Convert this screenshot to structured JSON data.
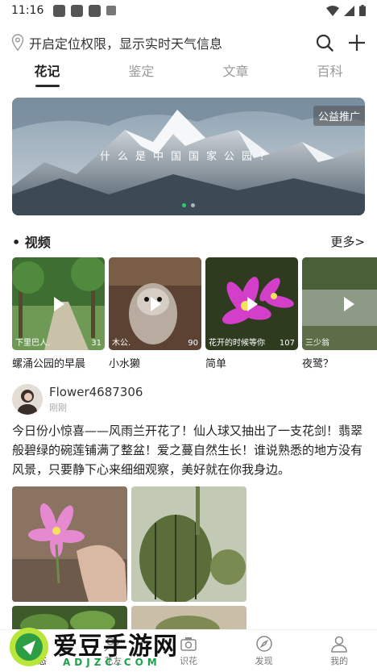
{
  "status_bar": {
    "time": "11:16"
  },
  "location": {
    "text": "开启定位权限，显示实时天气信息"
  },
  "tabs": [
    {
      "label": "花记"
    },
    {
      "label": "鉴定"
    },
    {
      "label": "文章"
    },
    {
      "label": "百科"
    }
  ],
  "banner": {
    "badge": "公益推广",
    "caption": "什么是中国国家公园？"
  },
  "videos_section": {
    "title": "视频",
    "more": "更多>",
    "items": [
      {
        "user": "下里巴人.",
        "count": "31",
        "title": "螺涌公园的早晨"
      },
      {
        "user": "木公.",
        "count": "90",
        "title": "小水獭"
      },
      {
        "user": "花开的时候等你",
        "count": "107",
        "title": "简单"
      },
      {
        "user": "三少翁",
        "count": "",
        "title": "夜鹭？"
      }
    ]
  },
  "post": {
    "username": "Flower4687306",
    "time": "刚刚",
    "text": "今日份小惊喜——风雨兰开花了！仙人球又抽出了一支花剑！翡翠般碧绿的碗莲铺满了整盆！爱之蔓自然生长！谁说熟悉的地方没有风景，只要静下心来细细观察，美好就在你我身边。"
  },
  "bottom_nav": [
    {
      "label": "动态",
      "icon": "home-icon"
    },
    {
      "label": "花友",
      "icon": "friends-icon"
    },
    {
      "label": "识花",
      "icon": "camera-icon"
    },
    {
      "label": "发现",
      "icon": "compass-icon"
    },
    {
      "label": "我的",
      "icon": "user-icon"
    }
  ],
  "watermark": {
    "text": "爱豆手游网",
    "url": "ADJZC.COM"
  },
  "colors": {
    "accent": "#2ecc71",
    "text": "#222222",
    "muted": "#999999"
  }
}
